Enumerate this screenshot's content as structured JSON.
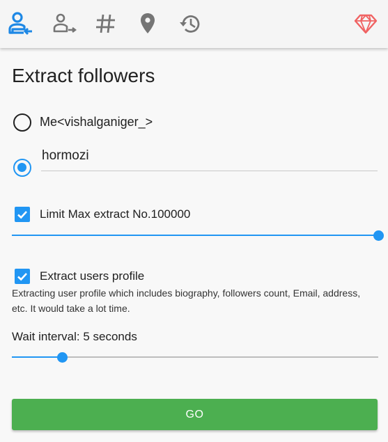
{
  "toolbar": {
    "icons": [
      {
        "name": "extract-followers-icon",
        "active": true
      },
      {
        "name": "extract-following-icon",
        "active": false
      },
      {
        "name": "hashtag-icon",
        "active": false
      },
      {
        "name": "location-pin-icon",
        "active": false
      },
      {
        "name": "history-icon",
        "active": false
      },
      {
        "name": "diamond-icon",
        "active": false
      }
    ],
    "colors": {
      "active": "#1e88e5",
      "inactive": "#757575",
      "diamond": "#f06262"
    }
  },
  "page": {
    "title": "Extract followers"
  },
  "target": {
    "options": [
      {
        "label": "Me<vishalganiger_>",
        "selected": false
      },
      {
        "label": "",
        "selected": true
      }
    ],
    "username_value": "hormozi"
  },
  "limit": {
    "checked": true,
    "label": "Limit Max extract No.100000",
    "slider_level": 1.0
  },
  "profile": {
    "checked": true,
    "label": "Extract users profile",
    "description": "Extracting user profile which includes biography, followers count, Email, address, etc. It would take a lot time."
  },
  "wait": {
    "label": "Wait interval: 5 seconds",
    "slider_level": 0.137
  },
  "go_button": {
    "label": "GO",
    "color": "#4caf50"
  },
  "accent_color": "#2196f3"
}
